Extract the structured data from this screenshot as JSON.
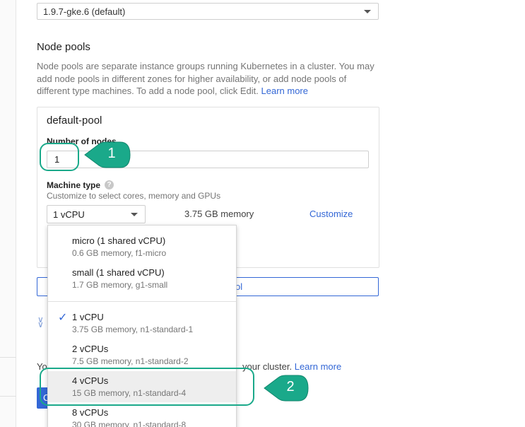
{
  "version": {
    "selected": "1.9.7-gke.6 (default)"
  },
  "node_pools": {
    "title": "Node pools",
    "description": "Node pools are separate instance groups running Kubernetes in a cluster. You may add node pools in different zones for higher availability, or add node pools of different type machines. To add a node pool, click Edit.",
    "learn_more": "Learn more",
    "pool": {
      "name": "default-pool",
      "nodes_label": "Number of nodes",
      "nodes_value": "1",
      "machine_type_label": "Machine type",
      "machine_type_hint": "Customize to select cores, memory and GPUs",
      "machine_type_selected": "1 vCPU",
      "memory": "3.75 GB memory",
      "customize": "Customize"
    },
    "add_pool_tail": "ol"
  },
  "cluster_note": {
    "prefix": "Yo",
    "suffix": "your cluster.",
    "learn_more": "Learn more"
  },
  "create_button_fragment": "C",
  "machine_options": [
    {
      "name": "micro (1 shared vCPU)",
      "detail": "0.6 GB memory, f1-micro"
    },
    {
      "name": "small (1 shared vCPU)",
      "detail": "1.7 GB memory, g1-small"
    },
    {
      "name": "1 vCPU",
      "detail": "3.75 GB memory, n1-standard-1",
      "checked": true
    },
    {
      "name": "2 vCPUs",
      "detail": "7.5 GB memory, n1-standard-2"
    },
    {
      "name": "4 vCPUs",
      "detail": "15 GB memory, n1-standard-4",
      "highlighted": true
    },
    {
      "name": "8 vCPUs",
      "detail": "30 GB memory, n1-standard-8"
    }
  ],
  "callouts": [
    "1",
    "2"
  ],
  "colors": {
    "accent": "#3367d6",
    "callout": "#1aa98a"
  }
}
